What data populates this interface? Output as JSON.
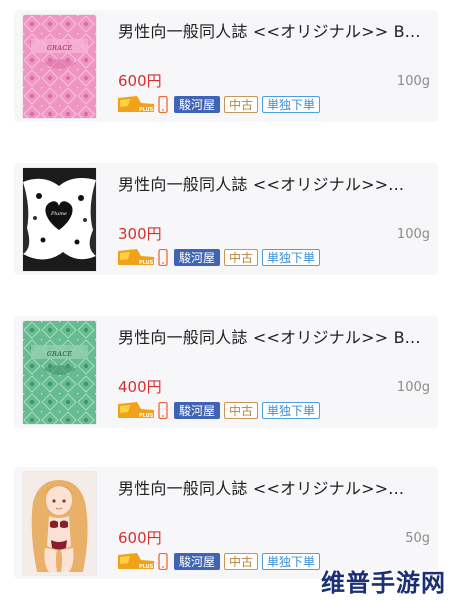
{
  "items": [
    {
      "title": "男性向一般同人誌 <<オリジナル>> B...",
      "price": "600円",
      "weight": "100g",
      "plus_badge_text": "PLUS",
      "tags": {
        "shop": "駿河屋",
        "condition": "中古",
        "order": "単独下単"
      },
      "cover": "pink-damask-cover"
    },
    {
      "title": "男性向一般同人誌 <<オリジナル>>...",
      "price": "300円",
      "weight": "100g",
      "plus_badge_text": "PLUS",
      "tags": {
        "shop": "駿河屋",
        "condition": "中古",
        "order": "単独下単"
      },
      "cover": "black-white-lace-cover"
    },
    {
      "title": "男性向一般同人誌 <<オリジナル>> B...",
      "price": "400円",
      "weight": "100g",
      "plus_badge_text": "PLUS",
      "tags": {
        "shop": "駿河屋",
        "condition": "中古",
        "order": "単独下単"
      },
      "cover": "green-damask-cover"
    },
    {
      "title": "男性向一般同人誌 <<オリジナル>>...",
      "price": "600円",
      "weight": "50g",
      "plus_badge_text": "PLUS",
      "tags": {
        "shop": "駿河屋",
        "condition": "中古",
        "order": "単独下単"
      },
      "cover": "anime-girl-cover"
    }
  ],
  "watermark": "维普手游网",
  "colors": {
    "price": "#d5302c",
    "shop_tag": "#3f63b7",
    "used_tag": "#b8843c",
    "single_tag": "#3b8fd4",
    "pink_cover": "#e88bb8",
    "green_cover": "#5fb38a"
  }
}
